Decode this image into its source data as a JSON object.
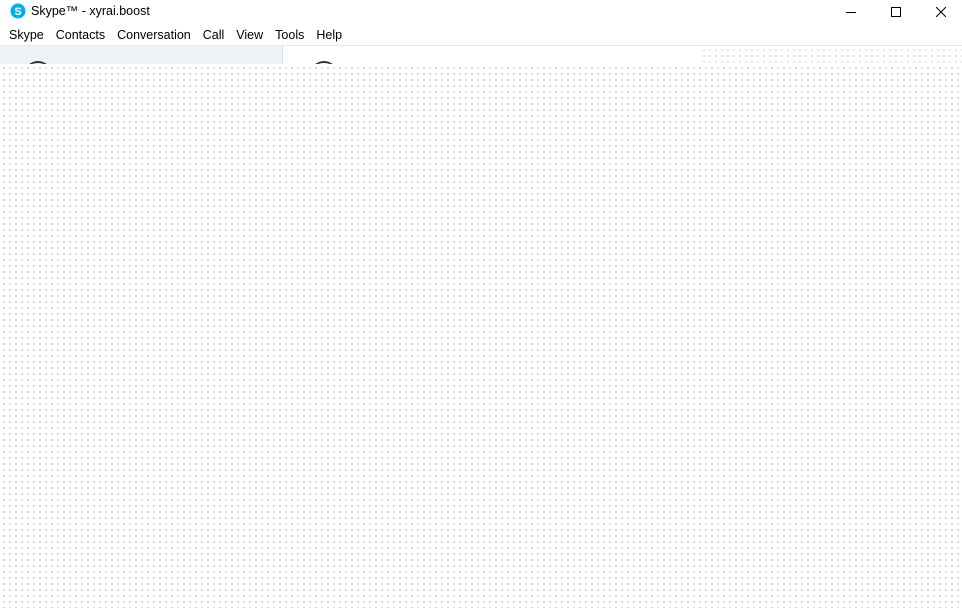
{
  "window": {
    "title": "Skype™ - xyrai.boost",
    "app_icon": "skype-icon",
    "controls": {
      "minimize_icon": "minimize-icon",
      "maximize_icon": "maximize-icon",
      "close_icon": "close-icon"
    }
  },
  "menu": {
    "items": [
      {
        "label": "Skype"
      },
      {
        "label": "Contacts"
      },
      {
        "label": "Conversation"
      },
      {
        "label": "Call"
      },
      {
        "label": "View"
      },
      {
        "label": "Tools"
      },
      {
        "label": "Help"
      }
    ]
  },
  "colors": {
    "skype_blue": "#00aff0",
    "left_panel_bg": "#eef2f7",
    "dot_color": "#cfcfcf"
  }
}
